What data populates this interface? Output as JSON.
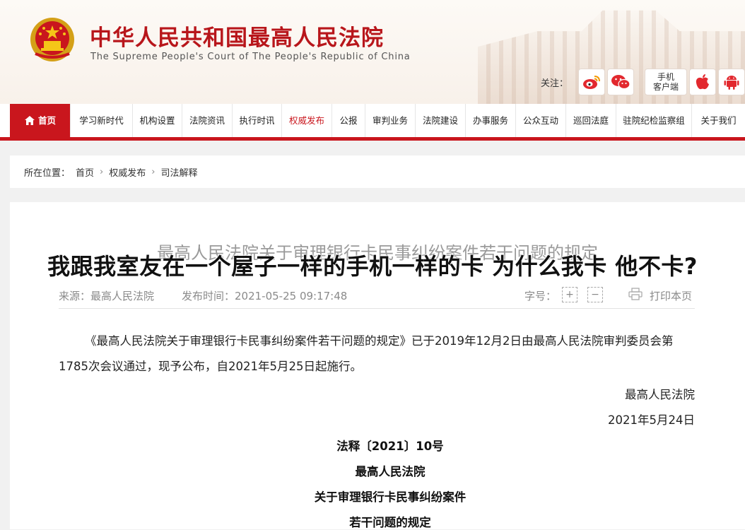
{
  "header": {
    "title": "中华人民共和国最高人民法院",
    "subtitle": "The Supreme People's Court of The People's Republic of China",
    "follow_label": "关注：",
    "mobile_label_1": "手机",
    "mobile_label_2": "客户端"
  },
  "nav": {
    "items": [
      "首页",
      "学习新时代",
      "机构设置",
      "法院资讯",
      "执行时讯",
      "权威发布",
      "公报",
      "审判业务",
      "法院建设",
      "办事服务",
      "公众互动",
      "巡回法庭",
      "驻院纪检监察组",
      "关于我们"
    ],
    "active_index": 5
  },
  "breadcrumb": {
    "label": "所在位置：",
    "items": [
      "首页",
      "权威发布",
      "司法解释"
    ]
  },
  "article": {
    "title": "最高人民法院关于审理银行卡民事纠纷案件若干问题的规定",
    "overlay_title": "我跟我室友在一个屋子一样的手机一样的卡 为什么我卡 他不卡?",
    "source": "来源：最高人民法院",
    "publish_time": "发布时间：2021-05-25 09:17:48",
    "font_size_label": "字号：",
    "print_label": "打印本页",
    "paragraph1": "《最高人民法院关于审理银行卡民事纠纷案件若干问题的规定》已于2019年12月2日由最高人民法院审判委员会第1785次会议通过，现予公布，自2021年5月25日起施行。",
    "signature_org": "最高人民法院",
    "signature_date": "2021年5月24日",
    "doc_number": "法释〔2021〕10号",
    "body_title_1": "最高人民法院",
    "body_title_2": "关于审理银行卡民事纠纷案件",
    "body_title_3": "若干问题的规定"
  },
  "colors": {
    "brand_red": "#c9161d",
    "title_red": "#b8161b"
  }
}
